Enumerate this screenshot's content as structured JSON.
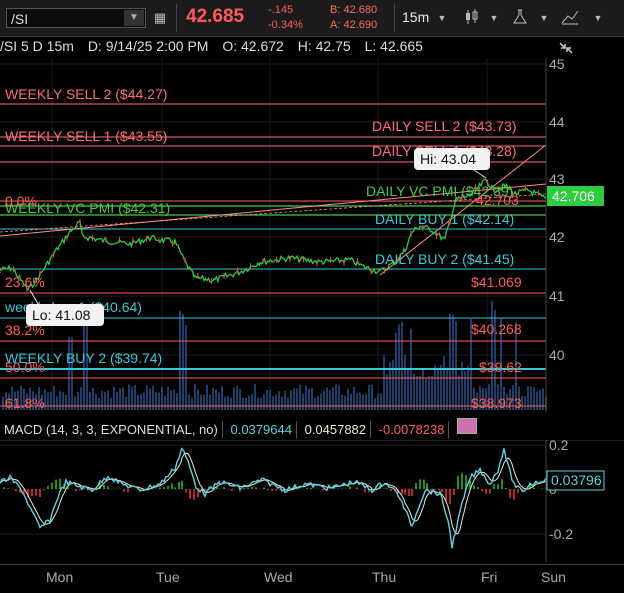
{
  "toolbar": {
    "symbol": "/SI",
    "last_price": "42.685",
    "net_change": "-.145",
    "pct_change": "-0.34%",
    "bid": "B: 42.680",
    "ask": "A: 42.690",
    "timeframe": "15m"
  },
  "info_bar": {
    "symbol_period": "/SI 5 D 15m",
    "date": "D: 9/14/25 2:00 PM",
    "open": "O: 42.672",
    "high": "H: 42.75",
    "low": "L: 42.665"
  },
  "price_axis": {
    "ticks": [
      "45",
      "44",
      "43",
      "42",
      "41",
      "40"
    ],
    "current_label": "42.706"
  },
  "levels": {
    "weekly_sell_2": "WEEKLY SELL 2 ($44.27)",
    "weekly_sell_1": "WEEKLY SELL 1 ($43.55)",
    "daily_sell_2": "DAILY SELL 2 ($43.73)",
    "daily_sell_1": "DAILY SELL 1 ($43.28)",
    "daily_vc_pmi": "DAILY VC PMI ($42.39)",
    "weekly_vc_pmi": "WEEKLY VC PMI ($42.31)",
    "daily_buy_1": "DAILY BUY 1 ($42.14)",
    "daily_buy_2": "DAILY BUY 2 ($41.45)",
    "weekly_buy_1": "weekly buy 1 ($40.64)",
    "weekly_buy_2": "WEEKLY BUY 2 ($39.74)"
  },
  "fib": {
    "pct_0": "0.0%",
    "pct_236": "23.6%",
    "pct_382": "38.2%",
    "pct_50": "50.0%",
    "pct_618": "61.8%",
    "val_1": "42.703",
    "val_2": "$41.069",
    "val_3": "$40.268",
    "val_4": "$39.62",
    "val_5": "$38.973"
  },
  "callouts": {
    "hi": "Hi: 43.04",
    "lo": "Lo: 41.08"
  },
  "macd": {
    "title": "MACD (14, 3, 3, EXPONENTIAL, no)",
    "value": "0.0379644",
    "avg": "0.0457882",
    "diff": "-0.0078238",
    "current_label": "0.03796",
    "ticks": [
      "0.2",
      "0",
      "-0.2"
    ]
  },
  "time_axis": [
    "Mon",
    "Tue",
    "Wed",
    "Thu",
    "Fri",
    "Sun"
  ],
  "colors": {
    "price_down": "#ff5b5b",
    "macd_line": "#5fd3e0",
    "avg_line": "#e8e8d0",
    "level_sell": "#ff6b7a",
    "level_pmi": "#44cc44",
    "level_buy": "#38c8d8",
    "current_price": "#2ecc40"
  }
}
